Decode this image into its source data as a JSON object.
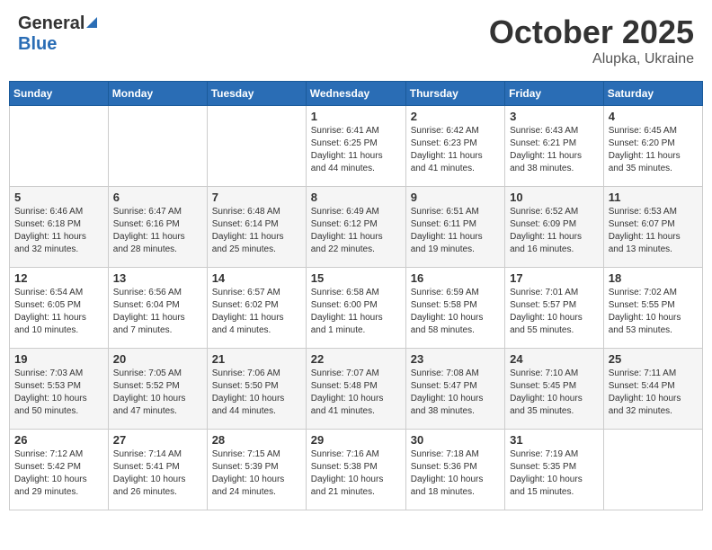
{
  "header": {
    "logo_general": "General",
    "logo_blue": "Blue",
    "month": "October 2025",
    "location": "Alupka, Ukraine"
  },
  "days_of_week": [
    "Sunday",
    "Monday",
    "Tuesday",
    "Wednesday",
    "Thursday",
    "Friday",
    "Saturday"
  ],
  "weeks": [
    [
      {
        "day": "",
        "info": ""
      },
      {
        "day": "",
        "info": ""
      },
      {
        "day": "",
        "info": ""
      },
      {
        "day": "1",
        "info": "Sunrise: 6:41 AM\nSunset: 6:25 PM\nDaylight: 11 hours\nand 44 minutes."
      },
      {
        "day": "2",
        "info": "Sunrise: 6:42 AM\nSunset: 6:23 PM\nDaylight: 11 hours\nand 41 minutes."
      },
      {
        "day": "3",
        "info": "Sunrise: 6:43 AM\nSunset: 6:21 PM\nDaylight: 11 hours\nand 38 minutes."
      },
      {
        "day": "4",
        "info": "Sunrise: 6:45 AM\nSunset: 6:20 PM\nDaylight: 11 hours\nand 35 minutes."
      }
    ],
    [
      {
        "day": "5",
        "info": "Sunrise: 6:46 AM\nSunset: 6:18 PM\nDaylight: 11 hours\nand 32 minutes."
      },
      {
        "day": "6",
        "info": "Sunrise: 6:47 AM\nSunset: 6:16 PM\nDaylight: 11 hours\nand 28 minutes."
      },
      {
        "day": "7",
        "info": "Sunrise: 6:48 AM\nSunset: 6:14 PM\nDaylight: 11 hours\nand 25 minutes."
      },
      {
        "day": "8",
        "info": "Sunrise: 6:49 AM\nSunset: 6:12 PM\nDaylight: 11 hours\nand 22 minutes."
      },
      {
        "day": "9",
        "info": "Sunrise: 6:51 AM\nSunset: 6:11 PM\nDaylight: 11 hours\nand 19 minutes."
      },
      {
        "day": "10",
        "info": "Sunrise: 6:52 AM\nSunset: 6:09 PM\nDaylight: 11 hours\nand 16 minutes."
      },
      {
        "day": "11",
        "info": "Sunrise: 6:53 AM\nSunset: 6:07 PM\nDaylight: 11 hours\nand 13 minutes."
      }
    ],
    [
      {
        "day": "12",
        "info": "Sunrise: 6:54 AM\nSunset: 6:05 PM\nDaylight: 11 hours\nand 10 minutes."
      },
      {
        "day": "13",
        "info": "Sunrise: 6:56 AM\nSunset: 6:04 PM\nDaylight: 11 hours\nand 7 minutes."
      },
      {
        "day": "14",
        "info": "Sunrise: 6:57 AM\nSunset: 6:02 PM\nDaylight: 11 hours\nand 4 minutes."
      },
      {
        "day": "15",
        "info": "Sunrise: 6:58 AM\nSunset: 6:00 PM\nDaylight: 11 hours\nand 1 minute."
      },
      {
        "day": "16",
        "info": "Sunrise: 6:59 AM\nSunset: 5:58 PM\nDaylight: 10 hours\nand 58 minutes."
      },
      {
        "day": "17",
        "info": "Sunrise: 7:01 AM\nSunset: 5:57 PM\nDaylight: 10 hours\nand 55 minutes."
      },
      {
        "day": "18",
        "info": "Sunrise: 7:02 AM\nSunset: 5:55 PM\nDaylight: 10 hours\nand 53 minutes."
      }
    ],
    [
      {
        "day": "19",
        "info": "Sunrise: 7:03 AM\nSunset: 5:53 PM\nDaylight: 10 hours\nand 50 minutes."
      },
      {
        "day": "20",
        "info": "Sunrise: 7:05 AM\nSunset: 5:52 PM\nDaylight: 10 hours\nand 47 minutes."
      },
      {
        "day": "21",
        "info": "Sunrise: 7:06 AM\nSunset: 5:50 PM\nDaylight: 10 hours\nand 44 minutes."
      },
      {
        "day": "22",
        "info": "Sunrise: 7:07 AM\nSunset: 5:48 PM\nDaylight: 10 hours\nand 41 minutes."
      },
      {
        "day": "23",
        "info": "Sunrise: 7:08 AM\nSunset: 5:47 PM\nDaylight: 10 hours\nand 38 minutes."
      },
      {
        "day": "24",
        "info": "Sunrise: 7:10 AM\nSunset: 5:45 PM\nDaylight: 10 hours\nand 35 minutes."
      },
      {
        "day": "25",
        "info": "Sunrise: 7:11 AM\nSunset: 5:44 PM\nDaylight: 10 hours\nand 32 minutes."
      }
    ],
    [
      {
        "day": "26",
        "info": "Sunrise: 7:12 AM\nSunset: 5:42 PM\nDaylight: 10 hours\nand 29 minutes."
      },
      {
        "day": "27",
        "info": "Sunrise: 7:14 AM\nSunset: 5:41 PM\nDaylight: 10 hours\nand 26 minutes."
      },
      {
        "day": "28",
        "info": "Sunrise: 7:15 AM\nSunset: 5:39 PM\nDaylight: 10 hours\nand 24 minutes."
      },
      {
        "day": "29",
        "info": "Sunrise: 7:16 AM\nSunset: 5:38 PM\nDaylight: 10 hours\nand 21 minutes."
      },
      {
        "day": "30",
        "info": "Sunrise: 7:18 AM\nSunset: 5:36 PM\nDaylight: 10 hours\nand 18 minutes."
      },
      {
        "day": "31",
        "info": "Sunrise: 7:19 AM\nSunset: 5:35 PM\nDaylight: 10 hours\nand 15 minutes."
      },
      {
        "day": "",
        "info": ""
      }
    ]
  ]
}
